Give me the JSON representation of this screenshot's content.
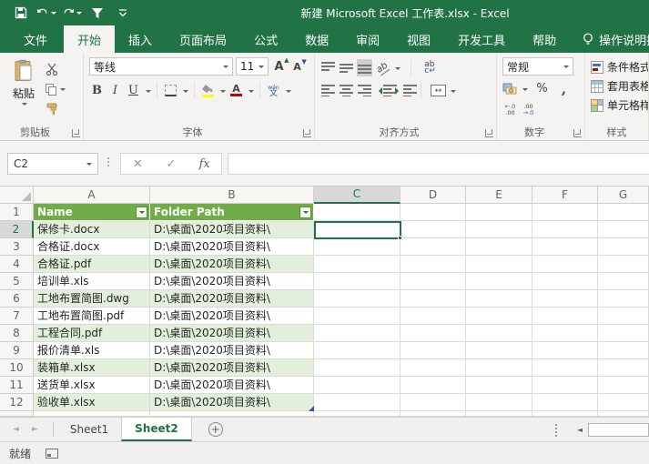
{
  "title_bar": {
    "title": "新建 Microsoft Excel 工作表.xlsx - Excel",
    "qat": {
      "save": "save-icon",
      "undo": "undo-icon",
      "redo": "redo-icon",
      "filter": "filter-icon",
      "customize": "customize-qat-icon"
    }
  },
  "ribbon": {
    "tabs": [
      {
        "key": "file",
        "label": "文件",
        "style": "file"
      },
      {
        "key": "home",
        "label": "开始",
        "style": "active"
      },
      {
        "key": "insert",
        "label": "插入",
        "style": "normal"
      },
      {
        "key": "page-layout",
        "label": "页面布局",
        "style": "normal"
      },
      {
        "key": "formulas",
        "label": "公式",
        "style": "normal"
      },
      {
        "key": "data",
        "label": "数据",
        "style": "normal"
      },
      {
        "key": "review",
        "label": "审阅",
        "style": "normal"
      },
      {
        "key": "view",
        "label": "视图",
        "style": "normal"
      },
      {
        "key": "developer",
        "label": "开发工具",
        "style": "normal"
      },
      {
        "key": "help",
        "label": "帮助",
        "style": "normal"
      }
    ],
    "tellme": "操作说明搜索",
    "groups": {
      "clipboard": {
        "label": "剪贴板",
        "paste": "粘贴"
      },
      "font": {
        "label": "字体",
        "font_name": "等线",
        "font_size": "11",
        "phonetic_top": "wén",
        "phonetic_bottom": "文"
      },
      "alignment": {
        "label": "对齐方式",
        "wrap_line1": "ab",
        "wrap_line2": "c↵",
        "orient": "ab",
        "merge": "↔"
      },
      "number": {
        "label": "数字",
        "format": "常规",
        "percent": "%",
        "comma": ",",
        "inc_dec_top": "←.0",
        "inc_dec_bottom": ".00",
        "dec_dec_top": ".00",
        "dec_dec_bottom": "→.0"
      },
      "styles": {
        "label": "样式",
        "items": [
          "条件格式",
          "套用表格格式",
          "单元格样式"
        ]
      }
    }
  },
  "formula_bar": {
    "name_box": "C2",
    "cancel": "✕",
    "enter": "✓",
    "fx": "fx",
    "value": ""
  },
  "grid": {
    "columns": [
      "A",
      "B",
      "C",
      "D",
      "E",
      "F",
      "G"
    ],
    "selected_column": "C",
    "selected_row": "2",
    "active_cell": "C2",
    "table_header": {
      "row": "1",
      "name": "Name",
      "path": "Folder Path"
    },
    "rows": [
      {
        "n": "2",
        "name": "保修卡.docx",
        "path": "D:\\桌面\\2020项目资料\\"
      },
      {
        "n": "3",
        "name": "合格证.docx",
        "path": "D:\\桌面\\2020项目资料\\"
      },
      {
        "n": "4",
        "name": "合格证.pdf",
        "path": "D:\\桌面\\2020项目资料\\"
      },
      {
        "n": "5",
        "name": "培训单.xls",
        "path": "D:\\桌面\\2020项目资料\\"
      },
      {
        "n": "6",
        "name": "工地布置简图.dwg",
        "path": "D:\\桌面\\2020项目资料\\"
      },
      {
        "n": "7",
        "name": "工地布置简图.pdf",
        "path": "D:\\桌面\\2020项目资料\\"
      },
      {
        "n": "8",
        "name": "工程合同.pdf",
        "path": "D:\\桌面\\2020项目资料\\"
      },
      {
        "n": "9",
        "name": "报价清单.xls",
        "path": "D:\\桌面\\2020项目资料\\"
      },
      {
        "n": "10",
        "name": "装箱单.xlsx",
        "path": "D:\\桌面\\2020项目资料\\"
      },
      {
        "n": "11",
        "name": "送货单.xlsx",
        "path": "D:\\桌面\\2020项目资料\\"
      },
      {
        "n": "12",
        "name": "验收单.xlsx",
        "path": "D:\\桌面\\2020项目资料\\"
      }
    ]
  },
  "sheet_tabs": {
    "tabs": [
      {
        "label": "Sheet1",
        "active": false
      },
      {
        "label": "Sheet2",
        "active": true
      }
    ]
  },
  "status_bar": {
    "ready": "就绪"
  },
  "colors": {
    "excel_green": "#217346",
    "table_header": "#70ad47",
    "band": "#e2efda"
  }
}
